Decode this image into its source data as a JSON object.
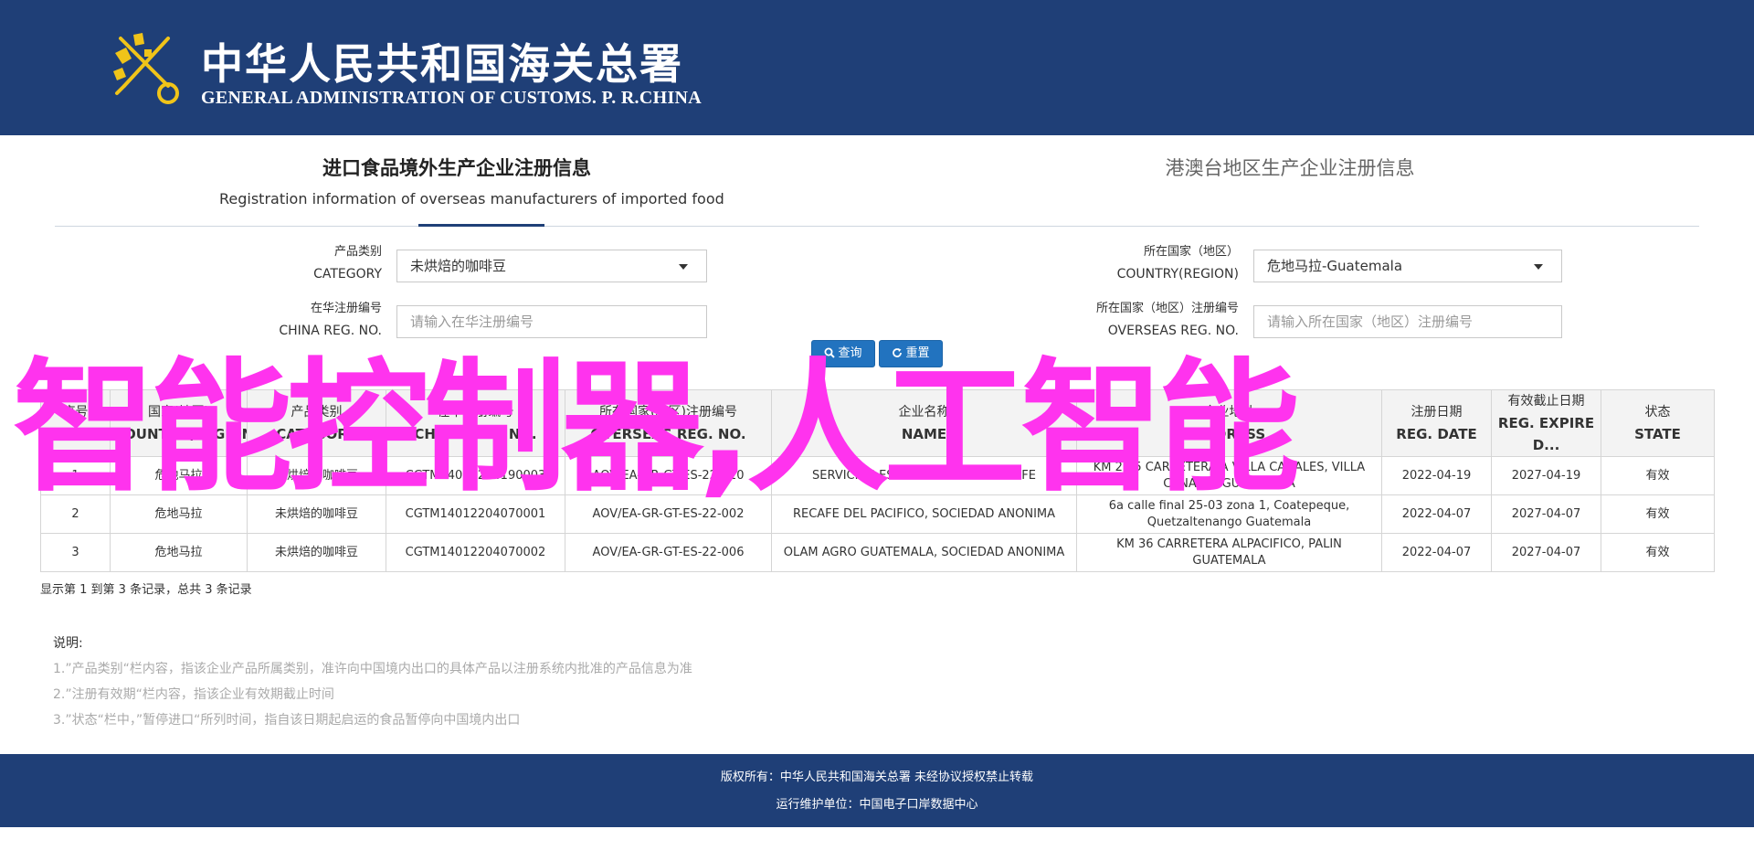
{
  "header": {
    "title_cn": "中华人民共和国海关总署",
    "title_en": "GENERAL ADMINISTRATION OF CUSTOMS. P. R.CHINA",
    "bg_color": "#1f3f77"
  },
  "tabs": [
    {
      "label_cn": "进口食品境外生产企业注册信息",
      "label_en": "Registration information of overseas manufacturers of imported food",
      "active": true
    },
    {
      "label_cn": "港澳台地区生产企业注册信息",
      "active": false
    }
  ],
  "form": {
    "category": {
      "label_cn": "产品类别",
      "label_en": "CATEGORY",
      "value": "未烘焙的咖啡豆"
    },
    "china_reg": {
      "label_cn": "在华注册编号",
      "label_en": "CHINA REG. NO.",
      "placeholder": "请输入在华注册编号"
    },
    "country": {
      "label_cn": "所在国家（地区）",
      "label_en": "COUNTRY(REGION)",
      "value": "危地马拉-Guatemala"
    },
    "overseas_reg": {
      "label_cn": "所在国家（地区）注册编号",
      "label_en": "OVERSEAS REG. NO.",
      "placeholder": "请输入所在国家（地区）注册编号"
    },
    "search_label": "查询",
    "reset_label": "重置",
    "button_color": "#2273bf"
  },
  "table": {
    "headers": [
      {
        "cn": "序号",
        "en": "NO."
      },
      {
        "cn": "国家(地区)",
        "en": "COUNTRY(REGION)"
      },
      {
        "cn": "产品类别",
        "en": "CATEGORY"
      },
      {
        "cn": "在华注册编号",
        "en": "CHINA REG. NO."
      },
      {
        "cn": "所在国家(地区)注册编号",
        "en": "OVERSEAS REG. NO."
      },
      {
        "cn": "企业名称",
        "en": "NAME"
      },
      {
        "cn": "企业地址",
        "en": "ADDRESS"
      },
      {
        "cn": "注册日期",
        "en": "REG. DATE"
      },
      {
        "cn": "有效截止日期",
        "en": "REG. EXPIRE D..."
      },
      {
        "cn": "状态",
        "en": "STATE"
      }
    ],
    "rows": [
      [
        "1",
        "危地马拉",
        "未烘焙的咖啡豆",
        "CGTM14012204190003",
        "AOV/EA-GR-GT-ES-22-010",
        "SERVICIOS ESPECIALIZADOS DE CAFE",
        "KM 21.5 CARRETERA A VILLA CANALES, VILLA CANALES GUATEMALA",
        "2022-04-19",
        "2027-04-19",
        "有效"
      ],
      [
        "2",
        "危地马拉",
        "未烘焙的咖啡豆",
        "CGTM14012204070001",
        "AOV/EA-GR-GT-ES-22-002",
        "RECAFE DEL PACIFICO, SOCIEDAD ANONIMA",
        "6a calle final 25-03 zona 1, Coatepeque, Quetzaltenango Guatemala",
        "2022-04-07",
        "2027-04-07",
        "有效"
      ],
      [
        "3",
        "危地马拉",
        "未烘焙的咖啡豆",
        "CGTM14012204070002",
        "AOV/EA-GR-GT-ES-22-006",
        "OLAM AGRO GUATEMALA, SOCIEDAD ANONIMA",
        "KM 36 CARRETERA ALPACIFICO, PALIN GUATEMALA",
        "2022-04-07",
        "2027-04-07",
        "有效"
      ]
    ]
  },
  "summary": "显示第 1 到第 3 条记录，总共 3 条记录",
  "notes": {
    "title": "说明:",
    "items": [
      "1.”产品类别“栏内容，指该企业产品所属类别，准许向中国境内出口的具体产品以注册系统内批准的产品信息为准",
      "2.”注册有效期“栏内容，指该企业有效期截止时间",
      "3.”状态“栏中，”暂停进口“所列时间，指自该日期起启运的食品暂停向中国境内出口"
    ]
  },
  "footer": {
    "line1": "版权所有：中华人民共和国海关总署 未经协议授权禁止转载",
    "line2": "运行维护单位：中国电子口岸数据中心"
  },
  "overlay_text": "智能控制器,人工智能",
  "overlay_color": "#ff33ee"
}
